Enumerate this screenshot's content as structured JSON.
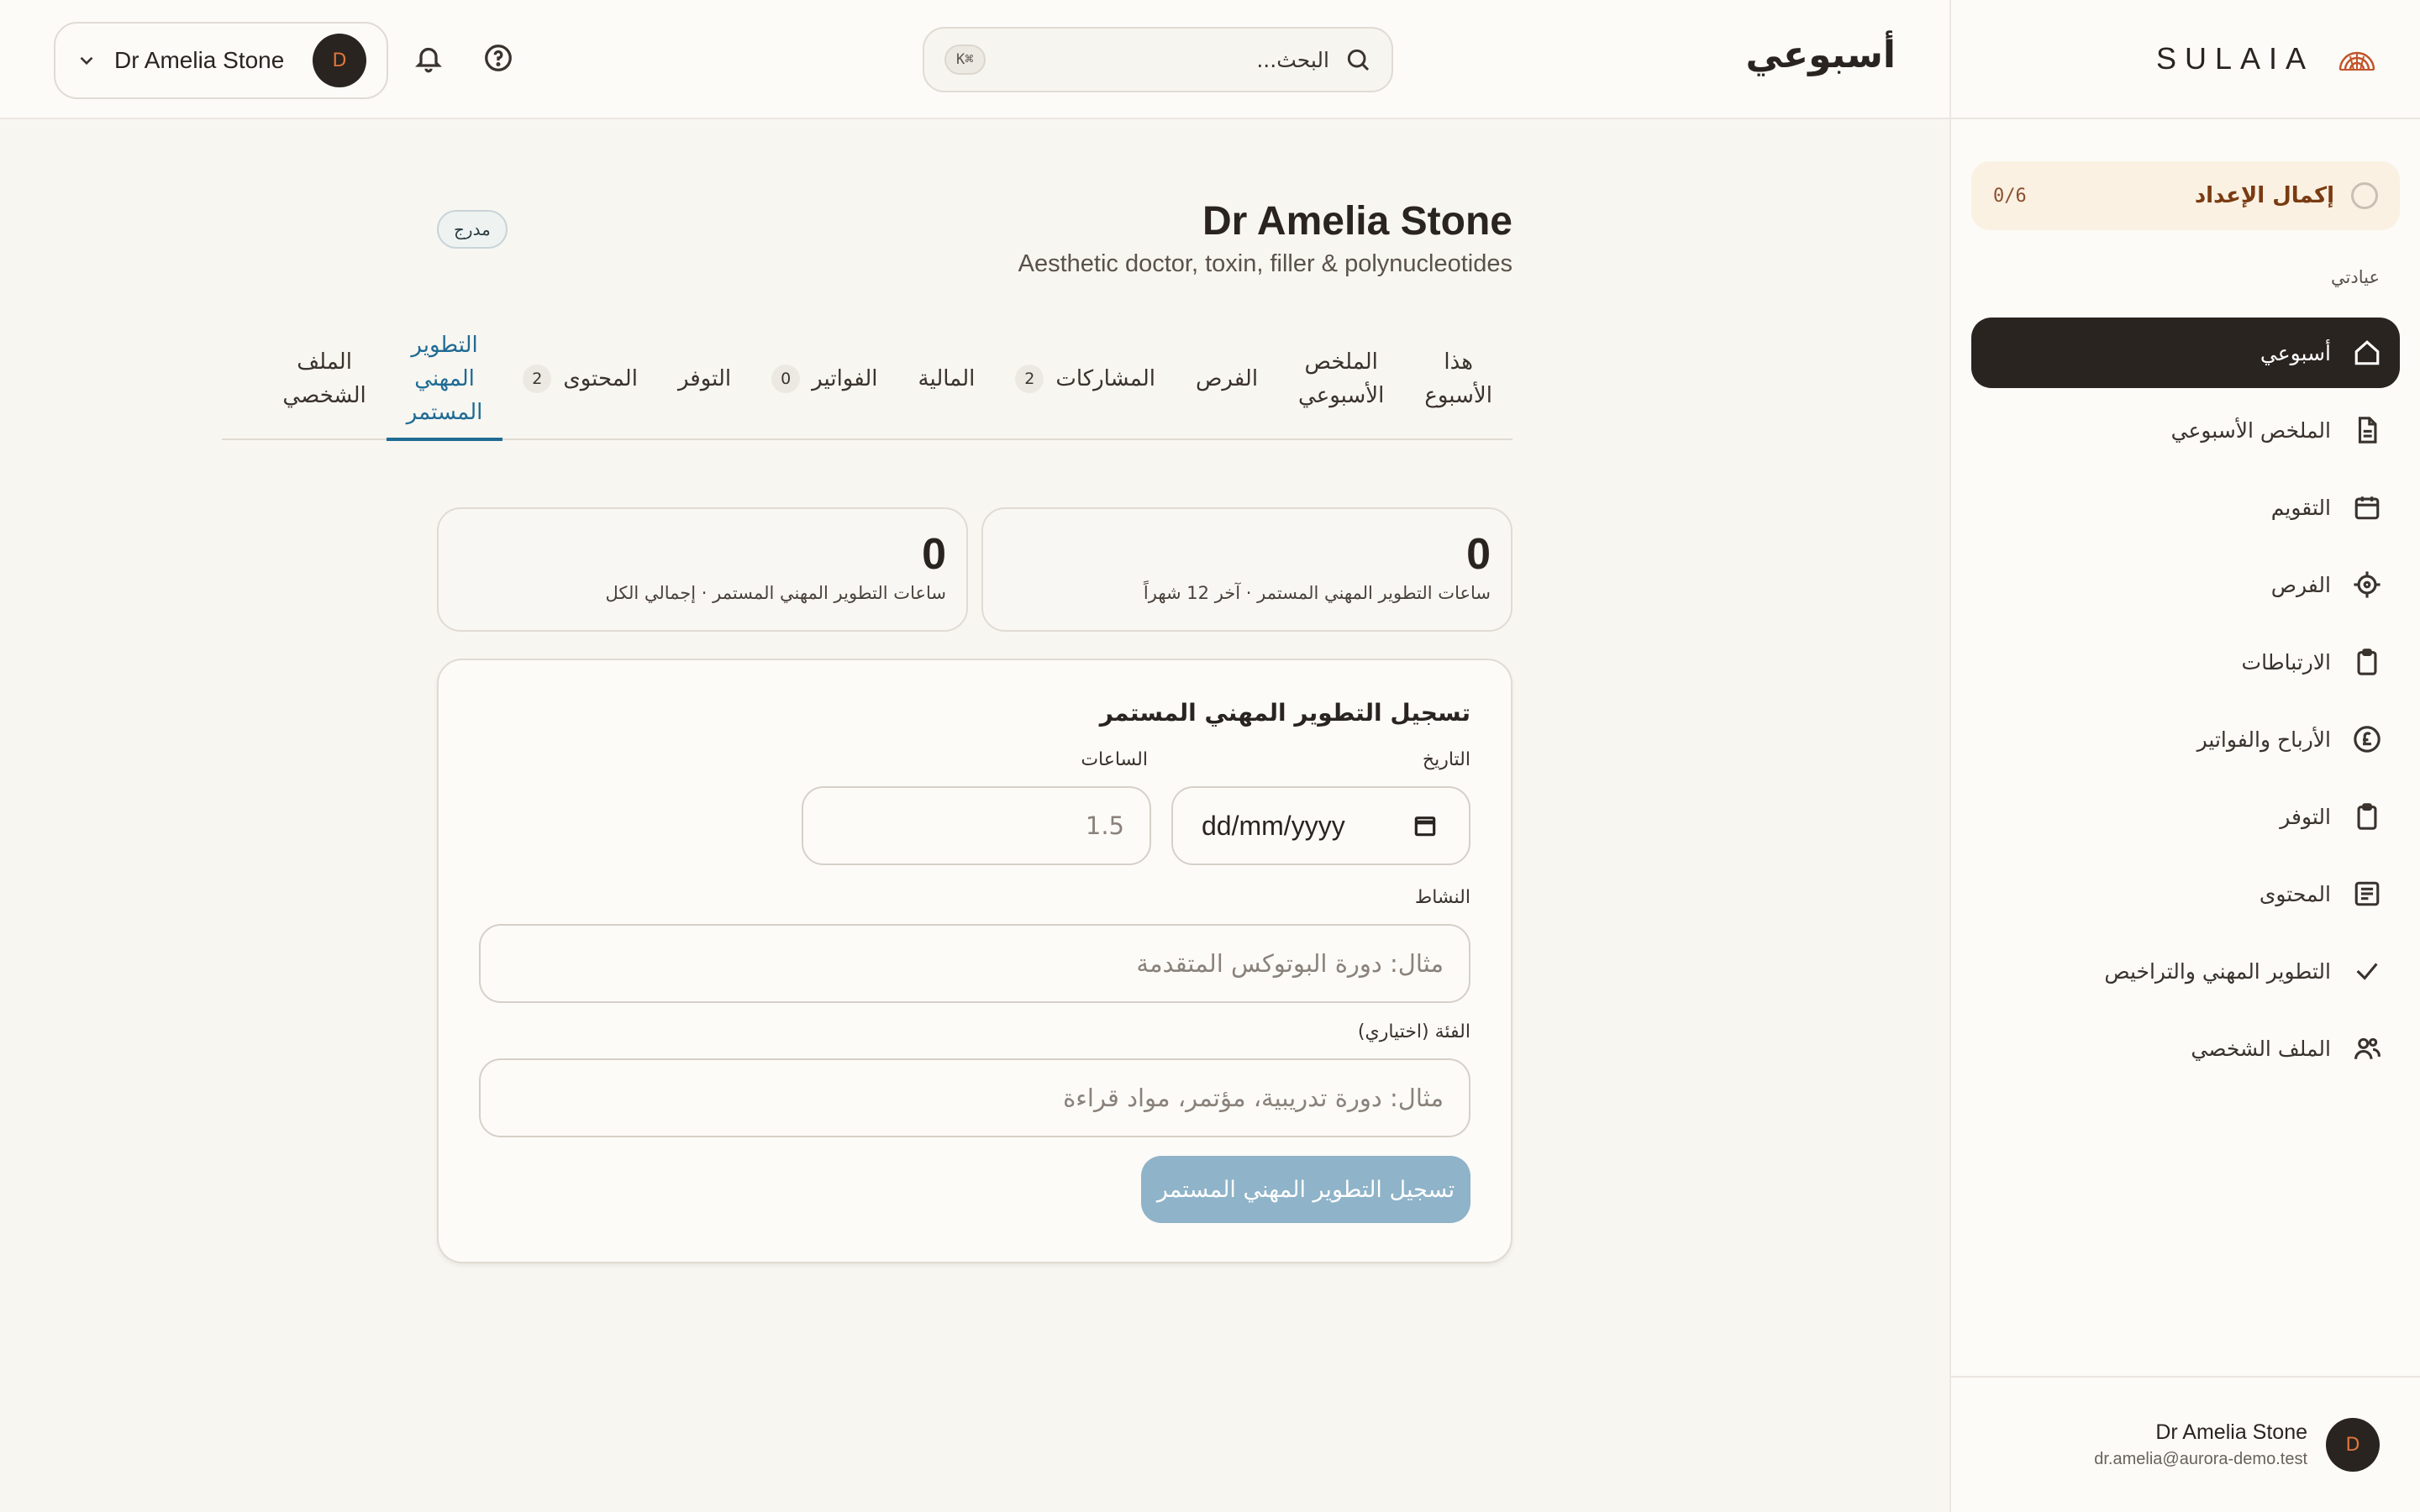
{
  "sidebar": {
    "brand": "SULAIA",
    "setup": {
      "label": "إكمال الإعداد",
      "count": "0/6"
    },
    "section_label": "عيادتي",
    "items": [
      {
        "label": "أسبوعي",
        "icon": "home-icon",
        "active": true
      },
      {
        "label": "الملخص الأسبوعي",
        "icon": "document-icon"
      },
      {
        "label": "التقويم",
        "icon": "calendar-icon"
      },
      {
        "label": "الفرص",
        "icon": "crosshair-icon"
      },
      {
        "label": "الارتباطات",
        "icon": "clipboard-icon"
      },
      {
        "label": "الأرباح والفواتير",
        "icon": "pound-icon"
      },
      {
        "label": "التوفر",
        "icon": "clipboard-icon"
      },
      {
        "label": "المحتوى",
        "icon": "newspaper-icon"
      },
      {
        "label": "التطوير المهني والتراخيص",
        "icon": "check-icon"
      },
      {
        "label": "الملف الشخصي",
        "icon": "users-icon"
      }
    ],
    "user": {
      "name": "Dr Amelia Stone",
      "email": "dr.amelia@aurora-demo.test",
      "initial": "D"
    }
  },
  "topbar": {
    "title": "أسبوعي",
    "search_placeholder": "البحث...",
    "shortcut": "⌘K",
    "user_name": "Dr Amelia Stone",
    "user_initial": "D"
  },
  "profile": {
    "name": "Dr Amelia Stone",
    "subtitle": "Aesthetic doctor, toxin, filler & polynucleotides",
    "status": "مدرج"
  },
  "tabs": [
    {
      "label": "هذا الأسبوع",
      "lines": [
        "هذا",
        "الأسبوع"
      ]
    },
    {
      "label": "الملخص الأسبوعي",
      "lines": [
        "الملخص",
        "الأسبوعي"
      ]
    },
    {
      "label": "الفرص",
      "lines": [
        "الفرص"
      ]
    },
    {
      "label": "المشاركات",
      "lines": [
        "المشاركات"
      ],
      "count": "2"
    },
    {
      "label": "المالية",
      "lines": [
        "المالية"
      ]
    },
    {
      "label": "الفواتير",
      "lines": [
        "الفواتير"
      ],
      "count": "0"
    },
    {
      "label": "التوفر",
      "lines": [
        "التوفر"
      ]
    },
    {
      "label": "المحتوى",
      "lines": [
        "المحتوى"
      ],
      "count": "2"
    },
    {
      "label": "التطوير المهني المستمر",
      "lines": [
        "التطوير",
        "المهني",
        "المستمر"
      ],
      "active": true
    },
    {
      "label": "الملف الشخصي",
      "lines": [
        "الملف",
        "الشخصي"
      ]
    }
  ],
  "stats": {
    "last12": {
      "value": "0",
      "label": "ساعات التطوير المهني المستمر · آخر 12 شهراً"
    },
    "total": {
      "value": "0",
      "label": "ساعات التطوير المهني المستمر · إجمالي الكل"
    }
  },
  "form": {
    "title": "تسجيل التطوير المهني المستمر",
    "date_label": "التاريخ",
    "date_value": "dd/mm/yyyy",
    "hours_label": "الساعات",
    "hours_placeholder": "1.5",
    "activity_label": "النشاط",
    "activity_placeholder": "مثال: دورة البوتوكس المتقدمة",
    "category_label": "الفئة (اختياري)",
    "category_placeholder": "مثال: دورة تدريبية، مؤتمر، مواد قراءة",
    "submit_label": "تسجيل التطوير المهني المستمر"
  },
  "colors": {
    "accent": "#1f6b94",
    "dark": "#2a2420",
    "setup_bg": "#faf1e2",
    "submit_bg": "#8fb3c8",
    "brand_icon": "#c2552a"
  }
}
